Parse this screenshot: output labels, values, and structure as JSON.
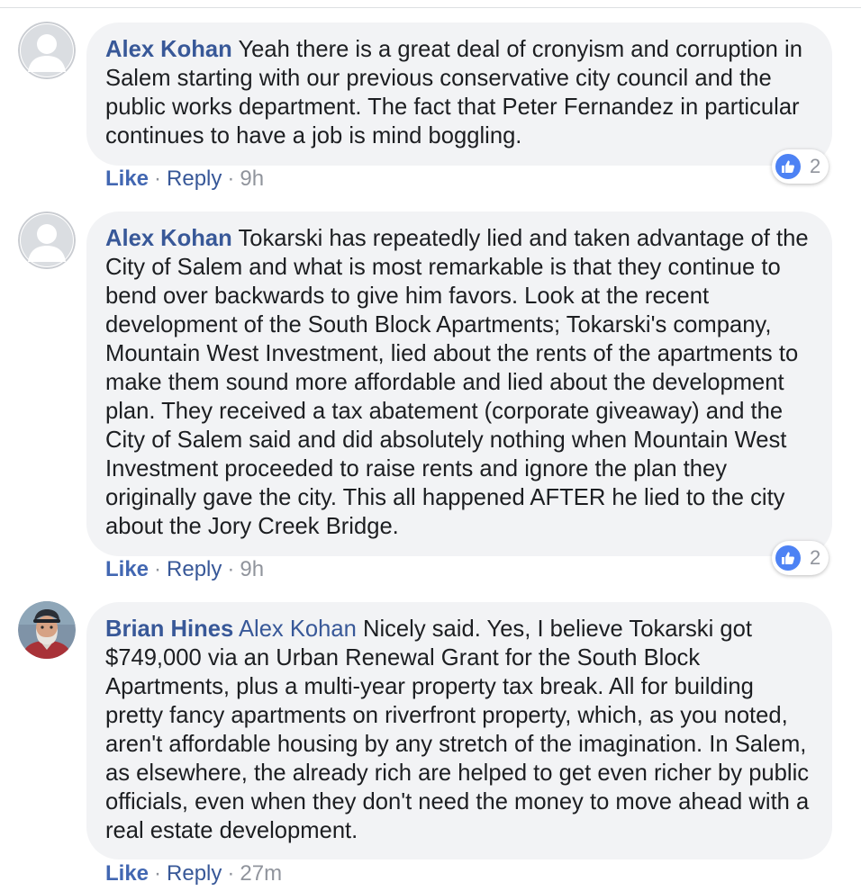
{
  "comments": [
    {
      "author": "Alex Kohan",
      "mention": "",
      "text": "Yeah there is a great deal of cronyism and corruption in Salem starting with our previous conservative city council and the public works department. The fact that Peter Fernandez in particular continues to have a job is mind boggling.",
      "like_label": "Like",
      "reply_label": "Reply",
      "separator": "·",
      "time": "9h",
      "reaction_count": "2",
      "avatar_icon": "default-profile-icon"
    },
    {
      "author": "Alex Kohan",
      "mention": "",
      "text": "Tokarski has repeatedly lied and taken advantage of the City of Salem and what is most remarkable is that they continue to bend over backwards to give him favors. Look at the recent development of the South Block Apartments; Tokarski's company, Mountain West Investment, lied about the rents of the apartments to make them sound more affordable and lied about the development plan. They received a tax abatement (corporate giveaway) and the City of Salem said and did absolutely nothing when Mountain West Investment proceeded to raise rents and ignore the plan they originally gave the city. This all happened AFTER he lied to the city about the Jory Creek Bridge.",
      "like_label": "Like",
      "reply_label": "Reply",
      "separator": "·",
      "time": "9h",
      "reaction_count": "2",
      "avatar_icon": "default-profile-icon"
    },
    {
      "author": "Brian Hines",
      "mention": "Alex Kohan",
      "text": "Nicely said. Yes, I believe Tokarski got $749,000 via an Urban Renewal Grant for the South Block Apartments, plus a multi-year property tax break. All for building pretty fancy apartments on riverfront property, which, as you noted, aren't affordable housing by any stretch of the imagination. In Salem, as elsewhere, the already rich are helped to get even richer by public officials, even when they don't need the money to move ahead with a real estate development.",
      "like_label": "Like",
      "reply_label": "Reply",
      "separator": "·",
      "time": "27m",
      "avatar_icon": "profile-photo"
    }
  ],
  "colors": {
    "name_link": "#385898",
    "like_link": "#4267b2",
    "bubble_bg": "#f2f3f5",
    "meta_gray": "#90949c",
    "like_badge": "#4d82f4"
  }
}
